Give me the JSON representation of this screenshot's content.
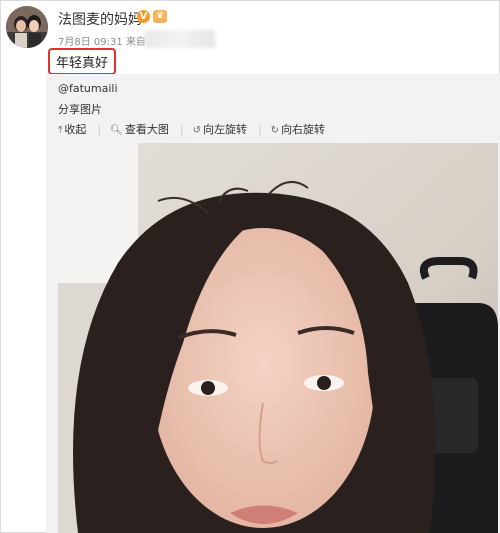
{
  "post": {
    "username": "法图麦的妈妈",
    "verified_badge": "V",
    "vip_badge": "♛",
    "meta": "7月8日 09:31 来自",
    "text": "年轻真好"
  },
  "repost": {
    "handle": "@fatumaili",
    "subtitle": "分享图片",
    "actions": [
      {
        "label": "收起",
        "icon": "collapse-arrow-icon"
      },
      {
        "label": "查看大图",
        "icon": "magnifier-icon"
      },
      {
        "label": "向左旋转",
        "icon": "rotate-left-icon"
      },
      {
        "label": "向右旋转",
        "icon": "rotate-right-icon"
      }
    ]
  },
  "colors": {
    "highlight_border": "#e23131",
    "badge": "#f79a2a",
    "meta_text": "#8b8b8b"
  }
}
